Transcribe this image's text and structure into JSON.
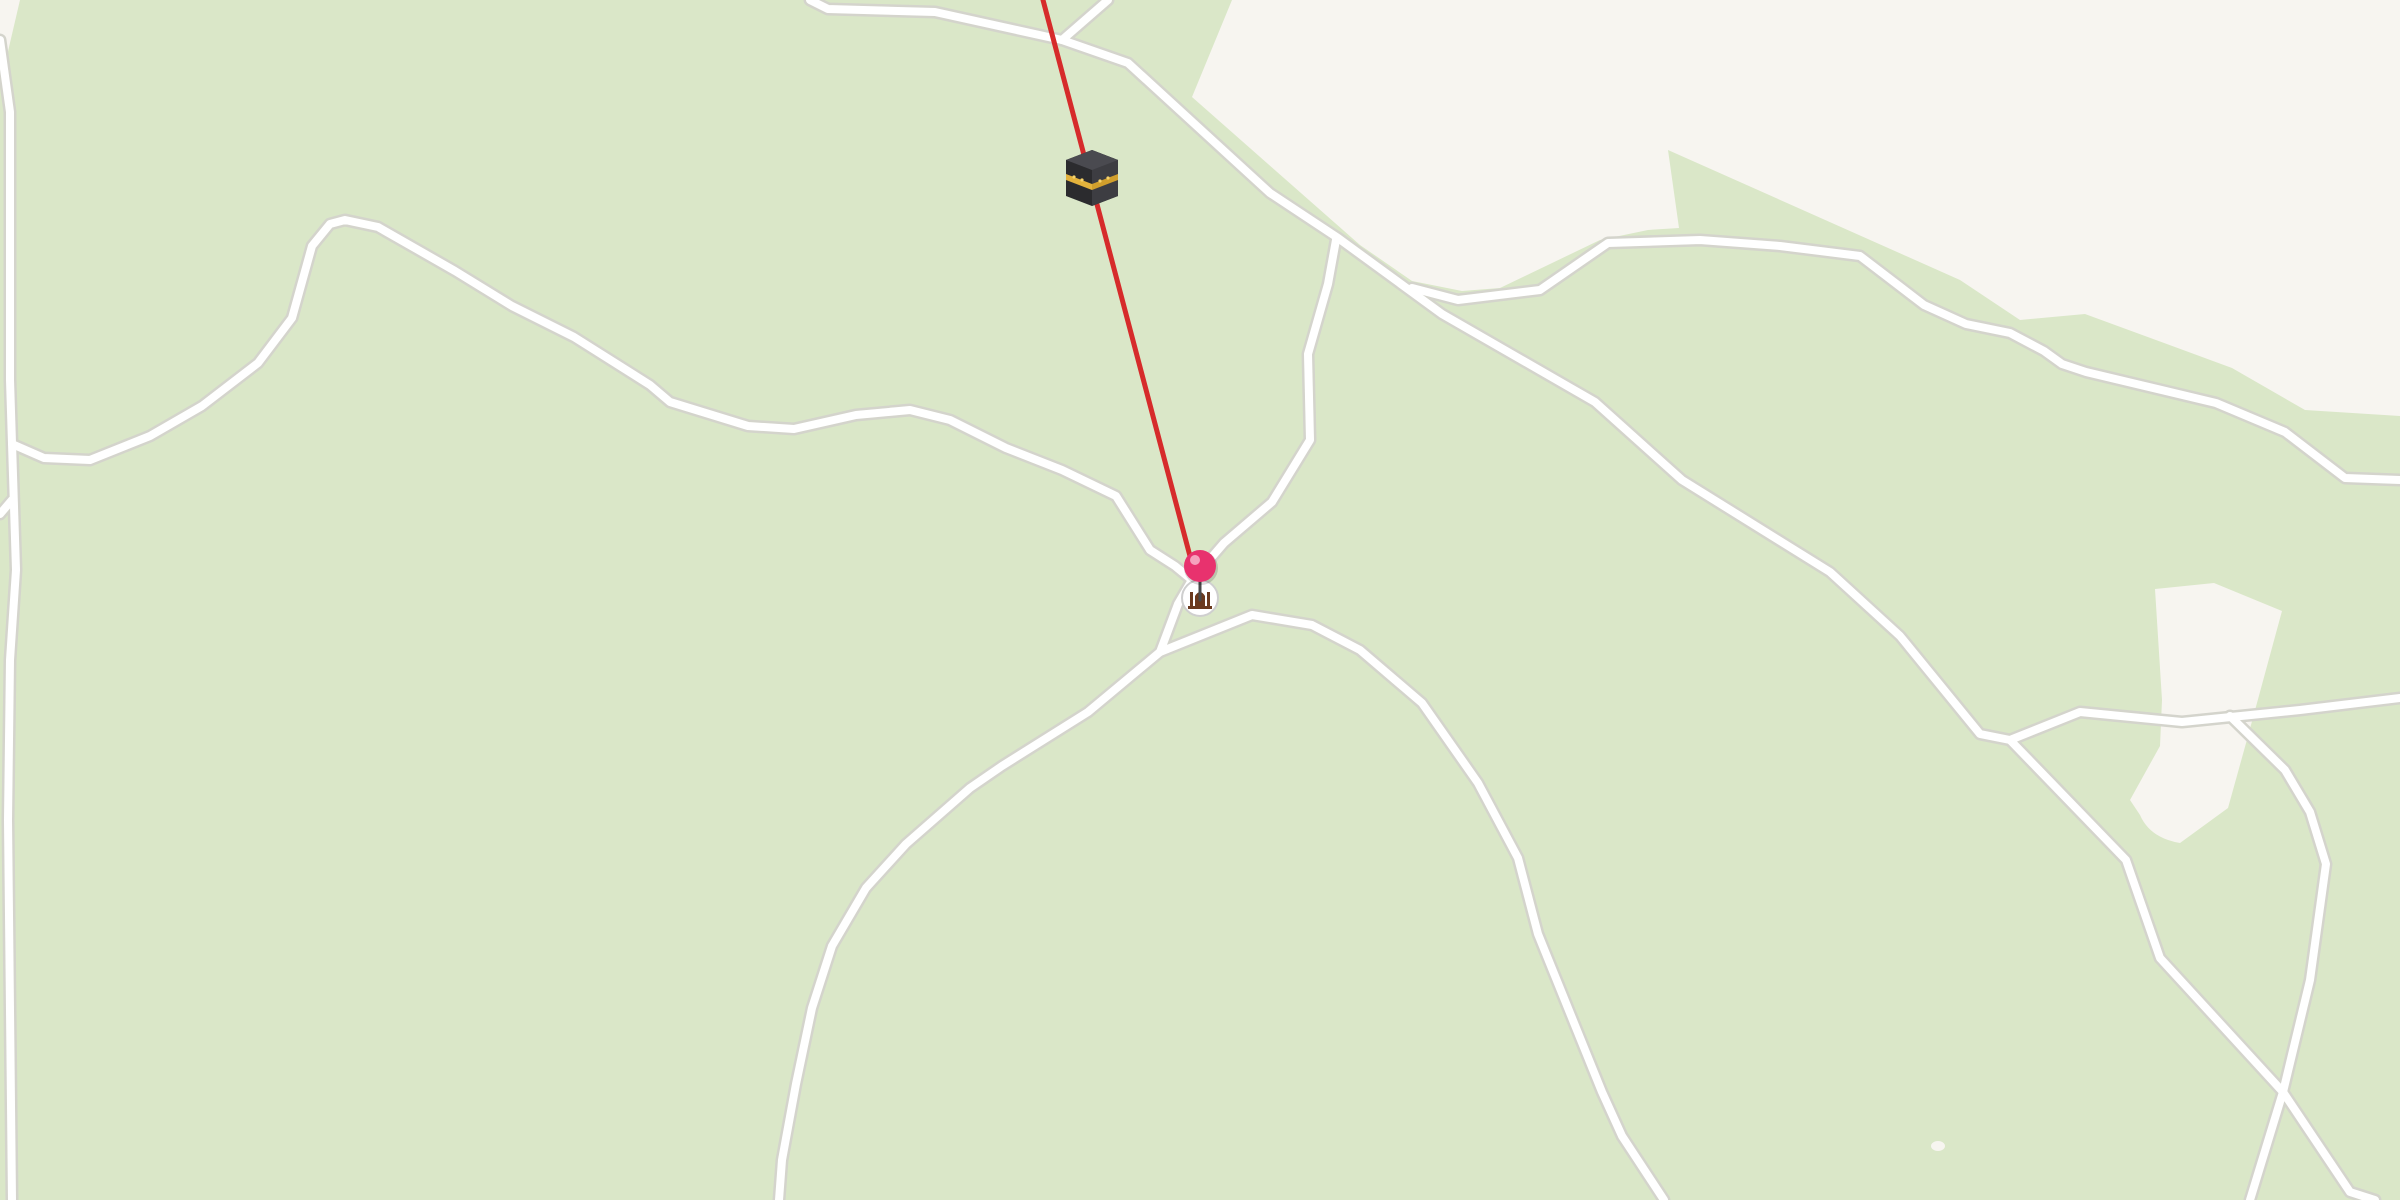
{
  "map": {
    "style": {
      "land_color": "#dae7c8",
      "built_area_color": "#f7f5f0",
      "road_color": "#ffffff",
      "road_casing_color": "#d4d4cc",
      "qibla_line_color": "#d62b2b",
      "pin_color": "#e8326e"
    },
    "markers": [
      {
        "id": "kaaba",
        "icon": "kaaba-icon",
        "label": ""
      },
      {
        "id": "location-pin",
        "icon": "map-pin-icon",
        "label": ""
      },
      {
        "id": "mosque",
        "icon": "mosque-icon",
        "label": ""
      }
    ],
    "overlays": [
      {
        "id": "qibla-direction",
        "type": "line",
        "label": ""
      }
    ]
  }
}
